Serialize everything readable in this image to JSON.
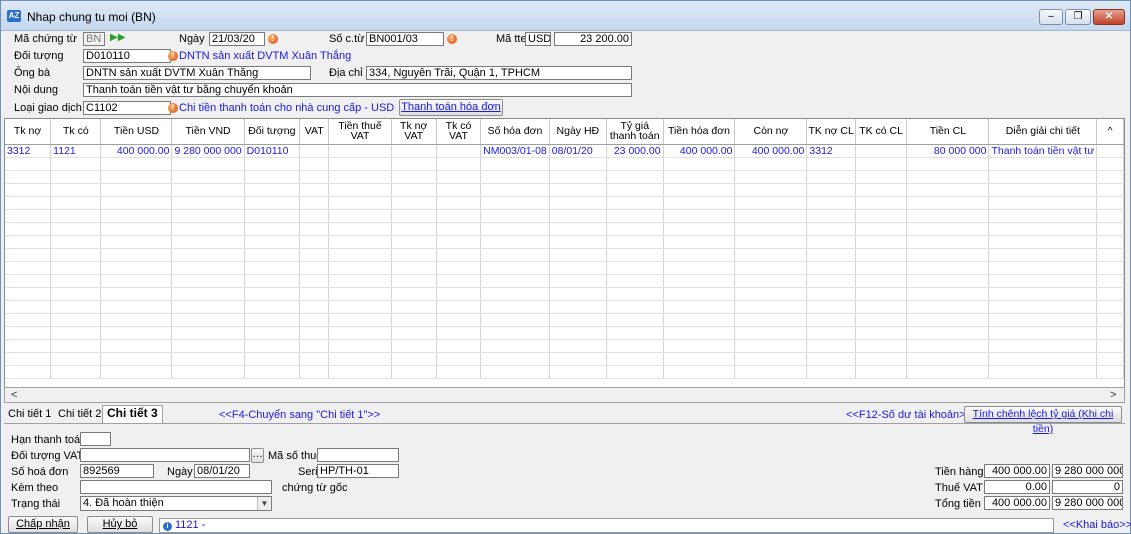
{
  "window": {
    "title": "Nhap chung tu moi (BN)",
    "app_icon": "AZ",
    "minimize": "–",
    "maximize": "❐",
    "close": "✕"
  },
  "header": {
    "ma_chung_tu_label": "Mã chứng từ",
    "ma_chung_tu": "BN",
    "ngay_label": "Ngày",
    "ngay": "21/03/20",
    "so_ctu_label": "Số c.từ",
    "so_ctu": "BN001/03",
    "ma_tte_label": "Mã tte",
    "ma_tte": "USD",
    "ty_gia": "23 200.00",
    "doi_tuong_label": "Đối tượng",
    "doi_tuong": "D010110",
    "doi_tuong_name": "DNTN sản xuất DVTM Xuân Thắng",
    "ong_ba_label": "Ông bà",
    "ong_ba": "DNTN sản xuất DVTM Xuân Thắng",
    "dia_chi_label": "Địa chỉ",
    "dia_chi": "334, Nguyễn Trãi, Quận 1, TPHCM",
    "noi_dung_label": "Nội dung",
    "noi_dung": "Thanh toán tiền vật tư bằng chuyển khoản",
    "loai_gd_label": "Loại giao dịch",
    "loai_gd": "C1102",
    "loai_gd_name": "Chi tiền thanh toán cho nhà cung cấp - USD",
    "thanh_toan_hd_button": "Thanh toán hóa đơn"
  },
  "grid": {
    "columns": [
      "Tk nợ",
      "Tk có",
      "Tiền USD",
      "Tiền VND",
      "Đối tượng",
      "VAT",
      "Tiền thuế VAT",
      "Tk nợ VAT",
      "Tk có VAT",
      "Số hóa đơn",
      "Ngày HĐ",
      "Tỷ giá thanh toán",
      "Tiền hóa đơn",
      "Còn nợ",
      "TK nợ CL",
      "TK có CL",
      "Tiền CL",
      "Diễn giải chi tiết"
    ],
    "rows": [
      [
        "3312",
        "1121",
        "400 000.00",
        "9 280 000 000",
        "D010110",
        "",
        "",
        "",
        "",
        "NM003/01-08",
        "08/01/20",
        "23 000.00",
        "400 000.00",
        "400 000.00",
        "3312",
        "",
        "80 000 000",
        "Thanh toán tiền vật tư"
      ]
    ]
  },
  "tabs": [
    "Chi tiết 1",
    "Chi tiết 2",
    "Chi tiết 3"
  ],
  "links": {
    "f4": "<<F4-Chuyển sang \"Chi tiết 1\">>",
    "f12": "<<F12-Số dư tài khoản>>",
    "tinh_cl": "Tính chênh lệch tỷ giá (Khi chi tiền)",
    "khai_bao": "<<Khai báo>>"
  },
  "detail": {
    "han_tt_label": "Hạn thanh toán",
    "han_tt": "",
    "doi_tuong_vat_label": "Đối tượng VAT",
    "doi_tuong_vat": "",
    "ma_so_thue_label": "Mã số thuế",
    "ma_so_thue": "",
    "so_hoa_don_label": "Số hoá đơn",
    "so_hoa_don": "892569",
    "ngay_label": "Ngày",
    "ngay": "08/01/20",
    "seri_label": "Seri",
    "seri": "HP/TH-01",
    "kem_theo_label": "Kèm theo",
    "kem_theo": "",
    "chung_tu_goc": "chứng từ gốc",
    "trang_thai_label": "Trạng thái",
    "trang_thai": "4. Đã hoàn thiện"
  },
  "totals": {
    "tien_hang_label": "Tiền hàng",
    "tien_hang_usd": "400 000.00",
    "tien_hang_vnd": "9 280 000 000",
    "thue_vat_label": "Thuế VAT",
    "thue_vat_usd": "0.00",
    "thue_vat_vnd": "0",
    "tong_tien_label": "Tổng tiền",
    "tong_tien_usd": "400 000.00",
    "tong_tien_vnd": "9 280 000 000"
  },
  "buttons": {
    "chap_nhan": "Chấp nhận",
    "huy_bo": "Hủy bỏ"
  },
  "status": {
    "text": "1121 -",
    "icon": "i"
  }
}
